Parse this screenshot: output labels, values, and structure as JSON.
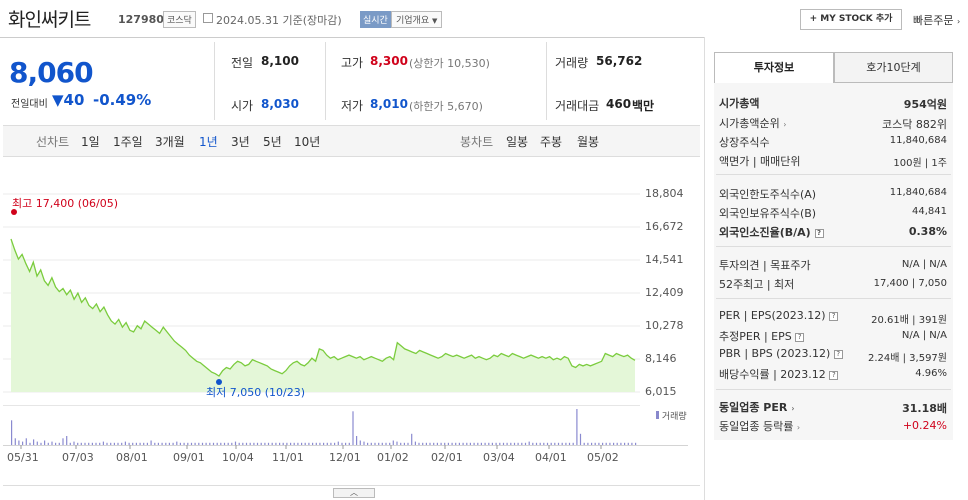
{
  "header": {
    "title": "화인써키트",
    "code": "127980",
    "market": "코스닥",
    "date_text": "2024.05.31  기준(장마감)",
    "realtime": "실시간",
    "overview": "기업개요",
    "mystock": "+ MY STOCK 추가",
    "quick_order": "빠른주문"
  },
  "price": {
    "current": "8,060",
    "compare_label": "전일대비",
    "change": "▼40",
    "change_pct": "-0.49%",
    "prev_label": "전일",
    "prev": "8,100",
    "high_label": "고가",
    "high": "8,300",
    "upper_limit": "(상한가 10,530)",
    "volume_label": "거래량",
    "volume": "56,762",
    "open_label": "시가",
    "open": "8,030",
    "low_label": "저가",
    "low": "8,010",
    "lower_limit": "(하한가 5,670)",
    "amount_label": "거래대금",
    "amount": "460",
    "amount_unit": "백만"
  },
  "tabs": {
    "line_label": "선차트",
    "line_tabs": [
      "1일",
      "1주일",
      "3개월",
      "1년",
      "3년",
      "5년",
      "10년"
    ],
    "selected": "1년",
    "candle_label": "봉차트",
    "candle_tabs": [
      "일봉",
      "주봉",
      "월봉"
    ]
  },
  "chart_data": {
    "type": "area",
    "title": "",
    "y_ticks": [
      "18,804",
      "16,672",
      "14,541",
      "12,409",
      "10,278",
      "8,146",
      "6,015"
    ],
    "ylim": [
      6015,
      18804
    ],
    "x_labels": [
      "05/31",
      "07/03",
      "08/01",
      "09/01",
      "10/04",
      "11/01",
      "12/01",
      "01/02",
      "02/01",
      "03/04",
      "04/01",
      "05/02"
    ],
    "high_annotation": "최고 17,400 (06/05)",
    "low_annotation": "최저 7,050 (10/23)",
    "high_value": 17400,
    "low_value": 7050,
    "close_series": [
      15900,
      15200,
      14600,
      14900,
      14300,
      13800,
      14400,
      13500,
      13900,
      13200,
      12900,
      13400,
      12800,
      12500,
      12700,
      12300,
      12600,
      12000,
      12400,
      11800,
      12100,
      11600,
      11400,
      11700,
      11200,
      11500,
      11000,
      10600,
      10400,
      10700,
      10200,
      10500,
      10000,
      9900,
      10300,
      10100,
      10600,
      10400,
      10200,
      10000,
      9800,
      10200,
      9900,
      9600,
      9300,
      9100,
      8900,
      8700,
      8400,
      8200,
      8000,
      7900,
      7700,
      7500,
      7300,
      7200,
      7050,
      7400,
      7600,
      7500,
      7800,
      8000,
      7900,
      7700,
      7800,
      8100,
      8000,
      7900,
      7800,
      7700,
      7500,
      7400,
      7300,
      7200,
      7400,
      7700,
      7900,
      8000,
      7800,
      7700,
      7900,
      8200,
      8000,
      8800,
      8700,
      8400,
      8200,
      8300,
      8100,
      8200,
      8300,
      8400,
      8300,
      8200,
      8300,
      8100,
      8200,
      8300,
      8200,
      8100,
      8000,
      8200,
      8300,
      8100,
      9200,
      9000,
      8800,
      8700,
      8600,
      8500,
      8700,
      8600,
      8500,
      8400,
      8300,
      8200,
      8300,
      8500,
      8400,
      8300,
      8400,
      8300,
      8200,
      8300,
      8400,
      8200,
      8300,
      8200,
      8100,
      8200,
      8400,
      8300,
      8500,
      8400,
      8300,
      8500,
      8400,
      8300,
      8200,
      8300,
      8400,
      8300,
      8200,
      8300,
      8200,
      8300,
      8100,
      8200,
      8100,
      8300,
      8200,
      7700,
      7600,
      7800,
      7700,
      7800,
      7700,
      7800,
      7900,
      8000,
      8500,
      8400,
      8300,
      8500,
      8400,
      8300,
      8400,
      8200,
      8060
    ],
    "volume_legend": "거래량",
    "volume_series": [
      22,
      6,
      4,
      3,
      6,
      2,
      5,
      3,
      2,
      4,
      2,
      3,
      2,
      2,
      6,
      8,
      2,
      3,
      2,
      2,
      2,
      2,
      2,
      2,
      2,
      3,
      2,
      2,
      2,
      2,
      2,
      3,
      2,
      2,
      2,
      2,
      2,
      2,
      4,
      2,
      2,
      2,
      2,
      2,
      2,
      3,
      2,
      2,
      2,
      2,
      2,
      2,
      2,
      2,
      2,
      2,
      2,
      2,
      2,
      2,
      2,
      3,
      2,
      2,
      2,
      2,
      2,
      2,
      2,
      2,
      2,
      2,
      2,
      2,
      2,
      2,
      2,
      2,
      2,
      2,
      2,
      2,
      2,
      2,
      2,
      2,
      2,
      2,
      2,
      3,
      2,
      2,
      2,
      30,
      8,
      4,
      3,
      2,
      2,
      2,
      2,
      2,
      2,
      2,
      4,
      3,
      2,
      2,
      2,
      10,
      3,
      2,
      2,
      2,
      2,
      2,
      2,
      2,
      2,
      2,
      2,
      2,
      2,
      2,
      2,
      2,
      2,
      2,
      2,
      2,
      2,
      2,
      2,
      2,
      2,
      2,
      2,
      2,
      2,
      2,
      2,
      3,
      2,
      2,
      2,
      2,
      2,
      2,
      2,
      2,
      2,
      2,
      2,
      2,
      32,
      10,
      2,
      2,
      2,
      2,
      2,
      2,
      2,
      2,
      2,
      2,
      2,
      2,
      2,
      2,
      2
    ]
  },
  "collapse": "︿",
  "right_panel": {
    "tab_invest": "투자정보",
    "tab_orderbook": "호가10단계",
    "rows": [
      {
        "label": "시가총액",
        "value": "954억원",
        "bold": true
      },
      {
        "label": "시가총액순위",
        "value": "코스닥 882위"
      },
      {
        "label": "상장주식수",
        "value": "11,840,684"
      },
      {
        "label": "액면가 | 매매단위",
        "value": "100원 | 1주"
      },
      {
        "label": "외국인한도주식수(A)",
        "value": "11,840,684"
      },
      {
        "label": "외국인보유주식수(B)",
        "value": "44,841"
      },
      {
        "label": "외국인소진율(B/A)",
        "value": "0.38%",
        "bold": true
      },
      {
        "label": "투자의견 | 목표주가",
        "value": "N/A | N/A"
      },
      {
        "label": "52주최고 | 최저",
        "value": "17,400 | 7,050"
      },
      {
        "label": "PER | EPS(2023.12)",
        "value": "20.61배 | 391원"
      },
      {
        "label": "추정PER | EPS",
        "value": "N/A | N/A"
      },
      {
        "label": "PBR | BPS (2023.12)",
        "value": "2.24배 | 3,597원"
      },
      {
        "label": "배당수익률 | 2023.12",
        "value": "4.96%"
      },
      {
        "label": "동일업종 PER",
        "value": "31.18배",
        "bold": true
      },
      {
        "label": "동일업종 등락률",
        "value": "+0.24%",
        "red": true
      }
    ]
  }
}
